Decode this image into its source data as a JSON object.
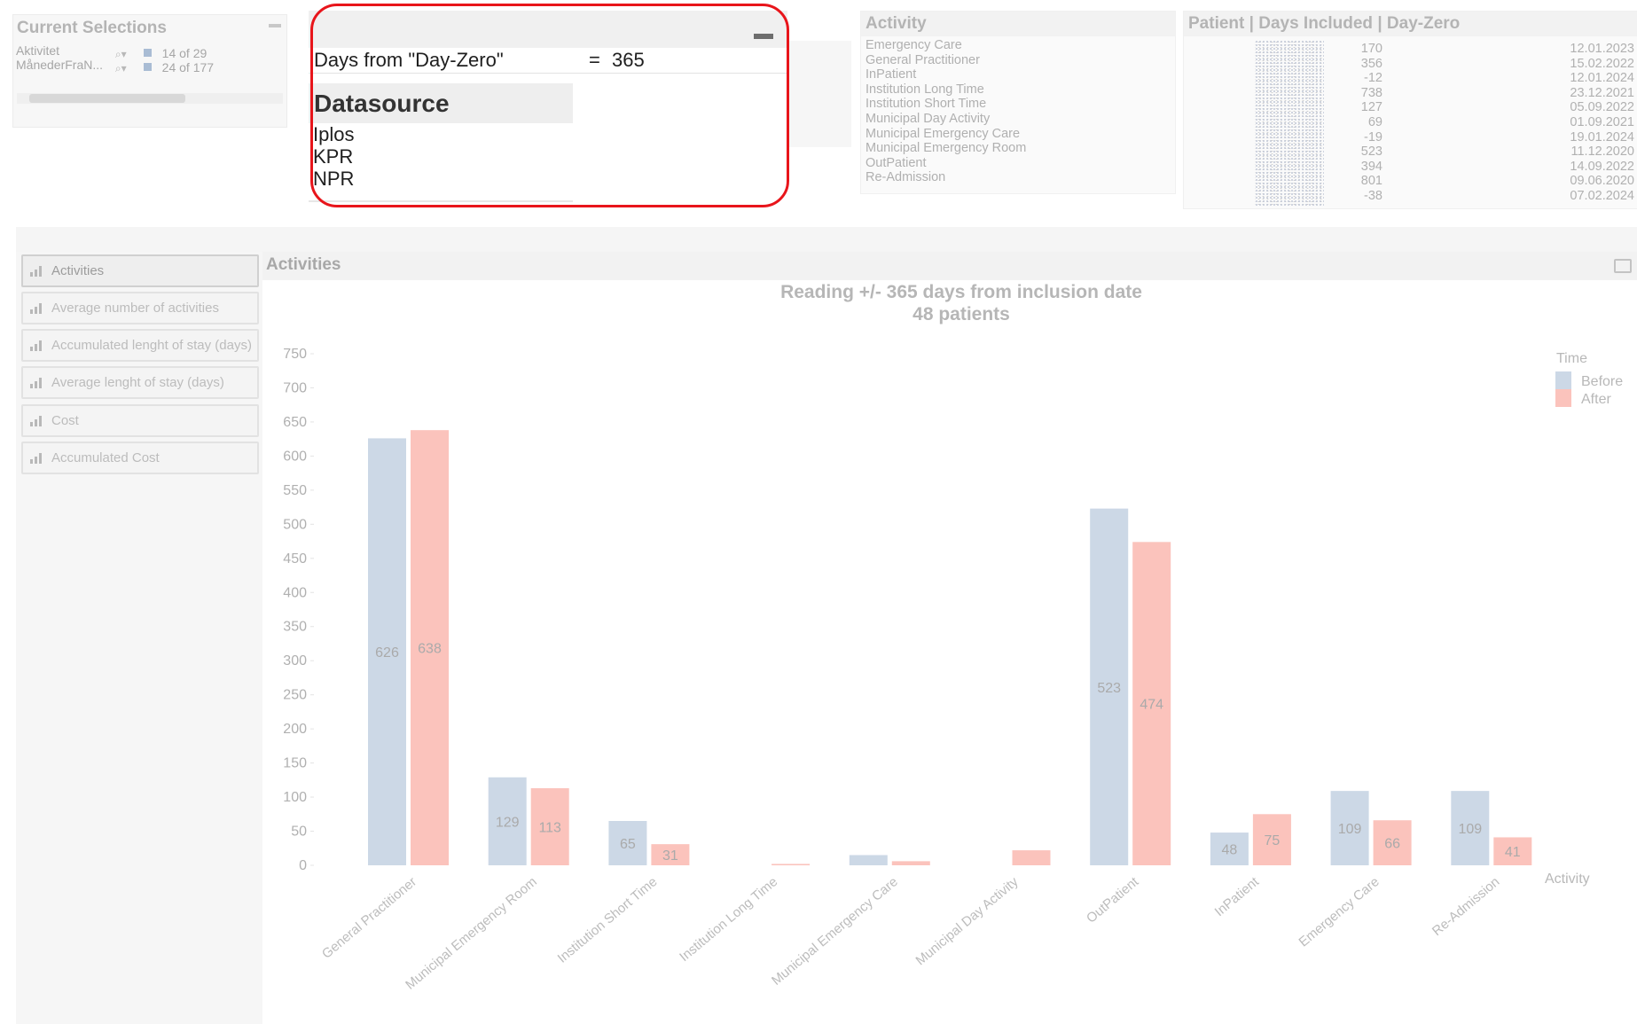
{
  "current_selections": {
    "title": "Current Selections",
    "rows": [
      {
        "field": "Aktivitet",
        "value": "14 of 29"
      },
      {
        "field": "MånederFraN...",
        "value": "24 of 177"
      }
    ]
  },
  "variable": {
    "label": "Days from \"Day-Zero\"",
    "eq": "=",
    "value": "365"
  },
  "datasource": {
    "title": "Datasource",
    "items": [
      "Iplos",
      "KPR",
      "NPR"
    ]
  },
  "activity_list": {
    "title": "Activity",
    "items": [
      "Emergency Care",
      "General Practitioner",
      "InPatient",
      "Institution Long Time",
      "Institution Short Time",
      "Municipal Day Activity",
      "Municipal Emergency Care",
      "Municipal Emergency Room",
      "OutPatient",
      "Re-Admission"
    ]
  },
  "patient_table": {
    "title": "Patient  |  Days Included  |  Day-Zero",
    "rows": [
      {
        "days": "170",
        "date": "12.01.2023"
      },
      {
        "days": "356",
        "date": "15.02.2022"
      },
      {
        "days": "-12",
        "date": "12.01.2024"
      },
      {
        "days": "738",
        "date": "23.12.2021"
      },
      {
        "days": "127",
        "date": "05.09.2022"
      },
      {
        "days": "69",
        "date": "01.09.2021"
      },
      {
        "days": "-19",
        "date": "19.01.2024"
      },
      {
        "days": "523",
        "date": "11.12.2020"
      },
      {
        "days": "394",
        "date": "14.09.2022"
      },
      {
        "days": "801",
        "date": "09.06.2020"
      },
      {
        "days": "-38",
        "date": "07.02.2024"
      }
    ]
  },
  "nav": {
    "items": [
      {
        "label": "Activities",
        "active": true
      },
      {
        "label": "Average number of activities",
        "active": false
      },
      {
        "label": "Accumulated lenght of stay (days)",
        "active": false
      },
      {
        "label": "Average lenght of stay (days)",
        "active": false
      },
      {
        "label": "Cost",
        "active": false
      },
      {
        "label": "Accumulated Cost",
        "active": false
      }
    ]
  },
  "chart_panel": {
    "title": "Activities"
  },
  "colors": {
    "before": "#ccd8e6",
    "after": "#fbc3bc",
    "highlight": "#e8151b"
  },
  "chart_data": {
    "type": "bar",
    "title": "Reading +/- 365 days from inclusion date",
    "subtitle": "48 patients",
    "xlabel": "Activity",
    "ylabel": "",
    "ylim": [
      0,
      750
    ],
    "yticks": [
      0,
      50,
      100,
      150,
      200,
      250,
      300,
      350,
      400,
      450,
      500,
      550,
      600,
      650,
      700,
      750
    ],
    "grid": false,
    "legend": {
      "title": "Time",
      "position": "top-right"
    },
    "categories": [
      "General Practitioner",
      "Municipal Emergency Room",
      "Institution Short Time",
      "Institution Long Time",
      "Municipal Emergency Care",
      "Municipal Day Activity",
      "OutPatient",
      "InPatient",
      "Emergency Care",
      "Re-Admission"
    ],
    "series": [
      {
        "name": "Before",
        "values": [
          626,
          129,
          65,
          0,
          15,
          0,
          523,
          48,
          109,
          109
        ],
        "labels": [
          "626",
          "129",
          "65",
          "",
          "",
          "",
          "523",
          "48",
          "109",
          "109"
        ]
      },
      {
        "name": "After",
        "values": [
          638,
          113,
          31,
          2,
          6,
          22,
          474,
          75,
          66,
          41
        ],
        "labels": [
          "638",
          "113",
          "31",
          "",
          "",
          "",
          "474",
          "75",
          "66",
          "41"
        ]
      }
    ]
  }
}
